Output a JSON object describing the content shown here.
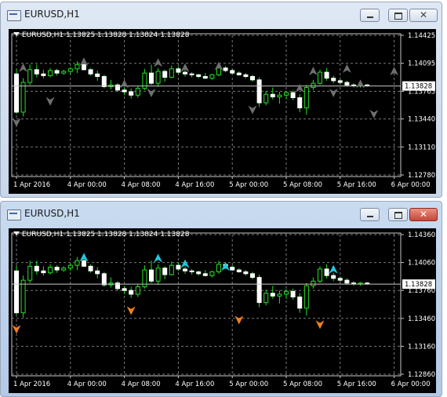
{
  "windows": [
    {
      "id": "top",
      "title": "EURUSD,H1",
      "header": "EURUSD,H1  1.13825 1.13828 1.13824 1.13828",
      "price_labels": [
        "1.14425",
        "1.14095",
        "1.13765",
        "1.13440",
        "1.13110",
        "1.12780"
      ],
      "current_price": "1.13828",
      "time_labels": [
        "1 Apr 2016",
        "4 Apr 00:00",
        "4 Apr 08:00",
        "4 Apr 16:00",
        "5 Apr 00:00",
        "5 Apr 08:00",
        "5 Apr 16:00",
        "6 Apr 00:00"
      ],
      "arrow_up_color": "#6f6f6f",
      "arrow_down_color": "#6f6f6f"
    },
    {
      "id": "bottom",
      "title": "EURUSD,H1",
      "header": "EURUSD,H1  1.13825 1.13828 1.13824 1.13828",
      "price_labels": [
        "1.14360",
        "1.14060",
        "1.13760",
        "1.13460",
        "1.13160",
        "1.12860"
      ],
      "current_price": "1.13828",
      "time_labels": [
        "1 Apr 2016",
        "4 Apr 00:00",
        "4 Apr 08:00",
        "4 Apr 16:00",
        "5 Apr 00:00",
        "5 Apr 08:00",
        "5 Apr 16:00",
        "6 Apr 00:00"
      ],
      "arrow_up_color": "#22c8e0",
      "arrow_down_color": "#f08020"
    }
  ],
  "candles": [
    {
      "o": 1.1397,
      "h": 1.1403,
      "l": 1.135,
      "c": 1.1352
    },
    {
      "o": 1.1352,
      "h": 1.1392,
      "l": 1.1347,
      "c": 1.1387
    },
    {
      "o": 1.1387,
      "h": 1.1408,
      "l": 1.1384,
      "c": 1.1402
    },
    {
      "o": 1.1402,
      "h": 1.1408,
      "l": 1.1393,
      "c": 1.1397
    },
    {
      "o": 1.1397,
      "h": 1.1402,
      "l": 1.1392,
      "c": 1.1395
    },
    {
      "o": 1.1395,
      "h": 1.1404,
      "l": 1.1393,
      "c": 1.1401
    },
    {
      "o": 1.1401,
      "h": 1.1403,
      "l": 1.1395,
      "c": 1.1398
    },
    {
      "o": 1.1398,
      "h": 1.1402,
      "l": 1.1396,
      "c": 1.14
    },
    {
      "o": 1.14,
      "h": 1.1405,
      "l": 1.1397,
      "c": 1.1403
    },
    {
      "o": 1.1403,
      "h": 1.1412,
      "l": 1.1398,
      "c": 1.1408
    },
    {
      "o": 1.1408,
      "h": 1.141,
      "l": 1.1401,
      "c": 1.1402
    },
    {
      "o": 1.1402,
      "h": 1.1404,
      "l": 1.1395,
      "c": 1.1397
    },
    {
      "o": 1.1397,
      "h": 1.1401,
      "l": 1.1389,
      "c": 1.1394
    },
    {
      "o": 1.1394,
      "h": 1.1396,
      "l": 1.138,
      "c": 1.1382
    },
    {
      "o": 1.1382,
      "h": 1.139,
      "l": 1.1379,
      "c": 1.1384
    },
    {
      "o": 1.1384,
      "h": 1.1386,
      "l": 1.1376,
      "c": 1.1378
    },
    {
      "o": 1.1378,
      "h": 1.1381,
      "l": 1.1372,
      "c": 1.1376
    },
    {
      "o": 1.1376,
      "h": 1.138,
      "l": 1.1368,
      "c": 1.1372
    },
    {
      "o": 1.1372,
      "h": 1.1383,
      "l": 1.1369,
      "c": 1.138
    },
    {
      "o": 1.138,
      "h": 1.1403,
      "l": 1.1378,
      "c": 1.1398
    },
    {
      "o": 1.1398,
      "h": 1.1408,
      "l": 1.1384,
      "c": 1.1386
    },
    {
      "o": 1.1386,
      "h": 1.1404,
      "l": 1.1382,
      "c": 1.14
    },
    {
      "o": 1.14,
      "h": 1.1402,
      "l": 1.1388,
      "c": 1.1393
    },
    {
      "o": 1.1393,
      "h": 1.1407,
      "l": 1.1392,
      "c": 1.1403
    },
    {
      "o": 1.1403,
      "h": 1.1406,
      "l": 1.1397,
      "c": 1.1399
    },
    {
      "o": 1.1399,
      "h": 1.1402,
      "l": 1.1394,
      "c": 1.1397
    },
    {
      "o": 1.1397,
      "h": 1.1399,
      "l": 1.1393,
      "c": 1.1396
    },
    {
      "o": 1.1396,
      "h": 1.1397,
      "l": 1.1392,
      "c": 1.1394
    },
    {
      "o": 1.1394,
      "h": 1.1398,
      "l": 1.1391,
      "c": 1.1392
    },
    {
      "o": 1.1392,
      "h": 1.1397,
      "l": 1.139,
      "c": 1.1396
    },
    {
      "o": 1.1396,
      "h": 1.1408,
      "l": 1.1394,
      "c": 1.1404
    },
    {
      "o": 1.1404,
      "h": 1.1406,
      "l": 1.1399,
      "c": 1.1401
    },
    {
      "o": 1.1401,
      "h": 1.1403,
      "l": 1.1397,
      "c": 1.1398
    },
    {
      "o": 1.1398,
      "h": 1.14,
      "l": 1.1395,
      "c": 1.1396
    },
    {
      "o": 1.1396,
      "h": 1.1398,
      "l": 1.1392,
      "c": 1.1394
    },
    {
      "o": 1.1394,
      "h": 1.1396,
      "l": 1.1388,
      "c": 1.139
    },
    {
      "o": 1.139,
      "h": 1.1393,
      "l": 1.1358,
      "c": 1.1363
    },
    {
      "o": 1.1363,
      "h": 1.1377,
      "l": 1.136,
      "c": 1.1373
    },
    {
      "o": 1.1373,
      "h": 1.1381,
      "l": 1.1367,
      "c": 1.137
    },
    {
      "o": 1.137,
      "h": 1.1376,
      "l": 1.1362,
      "c": 1.1372
    },
    {
      "o": 1.1372,
      "h": 1.1377,
      "l": 1.1367,
      "c": 1.1375
    },
    {
      "o": 1.1375,
      "h": 1.1378,
      "l": 1.1366,
      "c": 1.1369
    },
    {
      "o": 1.1369,
      "h": 1.1373,
      "l": 1.1352,
      "c": 1.1357
    },
    {
      "o": 1.1357,
      "h": 1.1384,
      "l": 1.1349,
      "c": 1.1381
    },
    {
      "o": 1.1381,
      "h": 1.139,
      "l": 1.1378,
      "c": 1.1386
    },
    {
      "o": 1.1386,
      "h": 1.1402,
      "l": 1.1384,
      "c": 1.1399
    },
    {
      "o": 1.1399,
      "h": 1.1404,
      "l": 1.1389,
      "c": 1.1392
    },
    {
      "o": 1.1392,
      "h": 1.1395,
      "l": 1.1386,
      "c": 1.1389
    },
    {
      "o": 1.1389,
      "h": 1.1391,
      "l": 1.1385,
      "c": 1.1387
    },
    {
      "o": 1.1387,
      "h": 1.1389,
      "l": 1.1382,
      "c": 1.1384
    },
    {
      "o": 1.1384,
      "h": 1.1386,
      "l": 1.1381,
      "c": 1.1383
    },
    {
      "o": 1.1383,
      "h": 1.1385,
      "l": 1.1381,
      "c": 1.1384
    },
    {
      "o": 1.1384,
      "h": 1.1385,
      "l": 1.1382,
      "c": 1.1383
    }
  ],
  "arrows_up_top": [
    [
      0,
      1.1335
    ],
    [
      5,
      1.136
    ],
    [
      20,
      1.137
    ],
    [
      35,
      1.135
    ],
    [
      47,
      1.137
    ],
    [
      53,
      1.1345
    ]
  ],
  "arrows_down_top": [
    [
      1,
      1.1409
    ],
    [
      10,
      1.1416
    ],
    [
      16,
      1.139
    ],
    [
      21,
      1.1415
    ],
    [
      25,
      1.1409
    ],
    [
      30,
      1.1411
    ],
    [
      42,
      1.1385
    ],
    [
      44,
      1.1405
    ],
    [
      49,
      1.1408
    ],
    [
      51,
      1.139
    ],
    [
      56,
      1.1405
    ]
  ],
  "arrows_up_bot": [
    [
      0,
      1.133
    ],
    [
      17,
      1.135
    ],
    [
      33,
      1.134
    ],
    [
      45,
      1.1335
    ]
  ],
  "arrows_down_bot": [
    [
      10,
      1.1416
    ],
    [
      21,
      1.1415
    ],
    [
      25,
      1.1409
    ],
    [
      31,
      1.1406
    ],
    [
      47,
      1.1403
    ]
  ]
}
